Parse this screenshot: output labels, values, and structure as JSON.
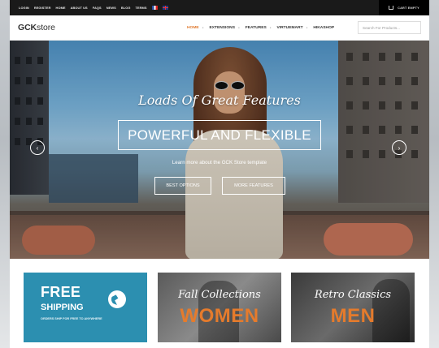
{
  "topbar": {
    "links": [
      "LOGIN",
      "REGISTER",
      "HOME",
      "ABOUT US",
      "FAQS",
      "NEWS",
      "BLOG",
      "TERMS"
    ],
    "cart_label": "CART EMPTY"
  },
  "header": {
    "logo_bold": "GCK",
    "logo_rest": "store",
    "nav": [
      {
        "label": "HOME",
        "active": true
      },
      {
        "label": "EXTENSIONS"
      },
      {
        "label": "FEATURES"
      },
      {
        "label": "VIRTUEMART"
      },
      {
        "label": "HIKASHOP"
      }
    ],
    "search_placeholder": "Search For Products..."
  },
  "hero": {
    "kicker": "Loads Of Great Features",
    "headline": "POWERFUL AND FLEXIBLE",
    "subtext": "Learn more about the GCK Store template",
    "btn_best": "BEST OPTIONS",
    "btn_more": "MORE FEATURES"
  },
  "tiles": {
    "shipping": {
      "title": "FREE",
      "subtitle": "SHIPPING",
      "note": "ORDERS SHIP FOR FREE TO ANYWHERE"
    },
    "women": {
      "kicker": "Fall Collections",
      "title": "WOMEN"
    },
    "men": {
      "kicker": "Retro Classics",
      "title": "MEN"
    }
  },
  "colors": {
    "accent": "#e07a2f",
    "shipping_tile": "#2c8fb0",
    "topbar": "#1a1a1a"
  }
}
